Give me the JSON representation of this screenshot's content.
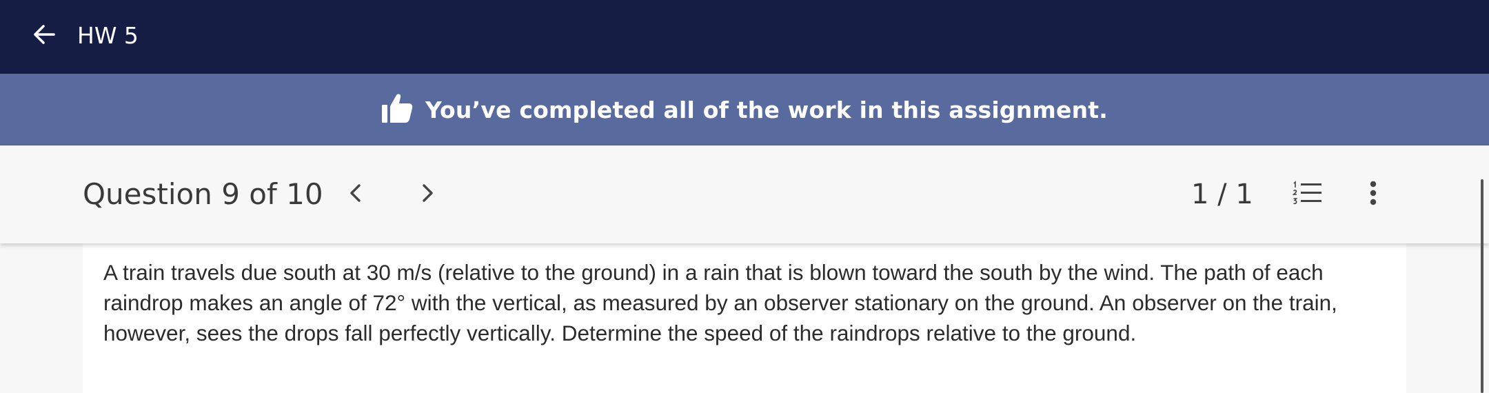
{
  "header": {
    "title": "HW 5",
    "back_icon": "arrow-left-icon",
    "background": "#161d44"
  },
  "banner": {
    "message": "You’ve completed all of the work in this assignment.",
    "icon": "thumbs-up-icon",
    "background": "#596a9e"
  },
  "question_bar": {
    "title": "Question 9 of 10",
    "prev_icon": "chevron-left-icon",
    "next_icon": "chevron-right-icon",
    "page_count": "1 / 1",
    "list_icon": "numbered-list-icon",
    "more_icon": "more-vertical-icon"
  },
  "question": {
    "text": "A train travels due south at 30 m/s (relative to the ground) in a rain that is blown toward the south by the wind. The path of each raindrop makes an angle of 72° with the vertical, as measured by an observer stationary on the ground. An observer on the train, however, sees the drops fall perfectly vertically. Determine the speed of the raindrops relative to the ground."
  }
}
